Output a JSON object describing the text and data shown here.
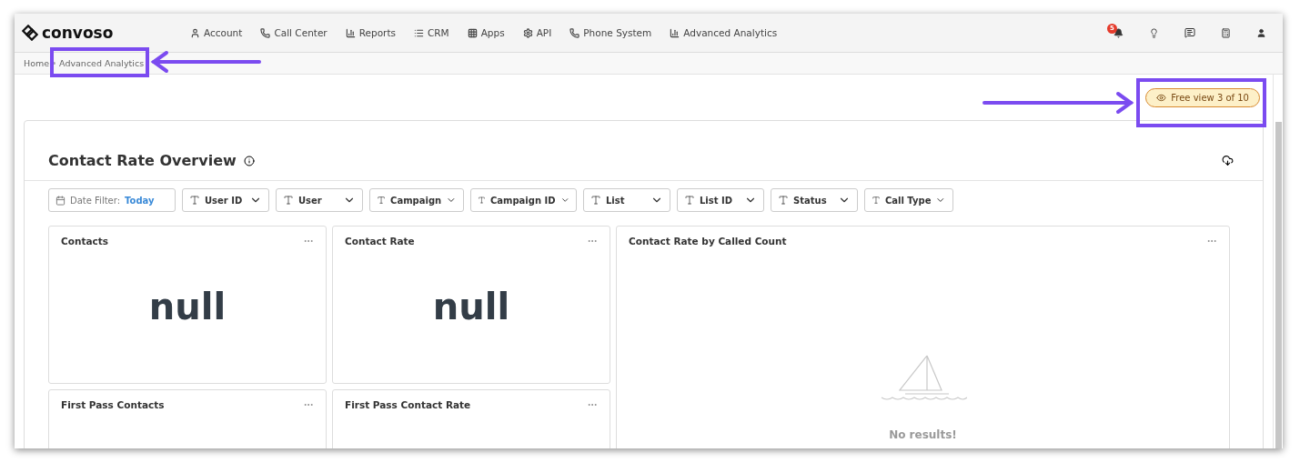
{
  "nav": {
    "logo": "convoso",
    "items": [
      {
        "label": "Account"
      },
      {
        "label": "Call Center"
      },
      {
        "label": "Reports"
      },
      {
        "label": "CRM"
      },
      {
        "label": "Apps"
      },
      {
        "label": "API"
      },
      {
        "label": "Phone System"
      },
      {
        "label": "Advanced Analytics"
      }
    ],
    "notification_count": "5"
  },
  "breadcrumb": [
    "Home",
    "Advanced Analytics"
  ],
  "free_view": "Free view 3 of 10",
  "dashboard": {
    "title": "Contact Rate Overview",
    "filters": [
      {
        "kind": "date",
        "label": "Date Filter:",
        "value": "Today"
      },
      {
        "kind": "text",
        "label": "User ID"
      },
      {
        "kind": "text",
        "label": "User"
      },
      {
        "kind": "text",
        "label": "Campaign"
      },
      {
        "kind": "text",
        "label": "Campaign ID"
      },
      {
        "kind": "text",
        "label": "List"
      },
      {
        "kind": "text",
        "label": "List ID"
      },
      {
        "kind": "text",
        "label": "Status"
      },
      {
        "kind": "text",
        "label": "Call Type"
      }
    ],
    "tiles": [
      {
        "title": "Contacts",
        "value": "null"
      },
      {
        "title": "Contact Rate",
        "value": "null"
      },
      {
        "title": "First Pass Contacts"
      },
      {
        "title": "First Pass Contact Rate"
      }
    ],
    "chart_tile": {
      "title": "Contact Rate by Called Count",
      "empty_message": "No results!"
    }
  }
}
